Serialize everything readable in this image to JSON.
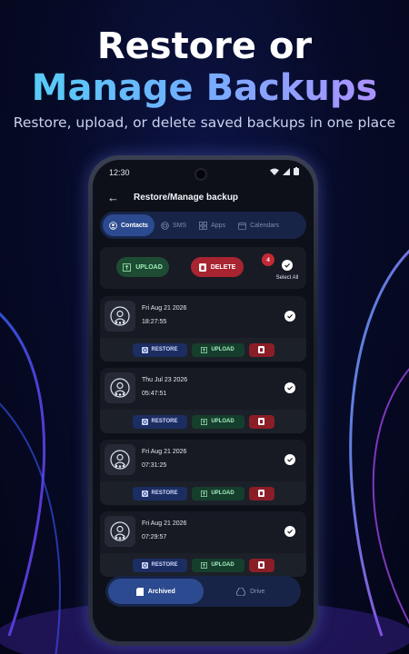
{
  "headline": {
    "line1": "Restore or",
    "line2": "Manage Backups"
  },
  "subline": "Restore, upload, or delete saved backups in one place",
  "status": {
    "time": "12:30"
  },
  "appbar": {
    "title": "Restore/Manage backup"
  },
  "tabs": [
    {
      "label": "Contacts",
      "icon": "contacts-icon",
      "active": true
    },
    {
      "label": "SMS",
      "icon": "sms-icon"
    },
    {
      "label": "Apps",
      "icon": "apps-icon"
    },
    {
      "label": "Calendars",
      "icon": "calendar-icon"
    }
  ],
  "actions": {
    "upload": "UPLOAD",
    "delete": "DELETE",
    "selected_count": "4",
    "select_all": "Select All"
  },
  "backups": [
    {
      "date": "Fri Aug 21 2026",
      "time": "18:27:55",
      "restore": "RESTORE",
      "upload": "UPLOAD"
    },
    {
      "date": "Thu Jul 23 2026",
      "time": "05:47:51",
      "restore": "RESTORE",
      "upload": "UPLOAD"
    },
    {
      "date": "Fri Aug 21 2026",
      "time": "07:31:25",
      "restore": "RESTORE",
      "upload": "UPLOAD"
    },
    {
      "date": "Fri Aug 21 2026",
      "time": "07:29:57",
      "restore": "RESTORE",
      "upload": "UPLOAD"
    }
  ],
  "bottomnav": {
    "archived": "Archived",
    "drive": "Drive"
  },
  "colors": {
    "accent": "#2c4a8f",
    "upload": "#1e4b33",
    "delete": "#a82430",
    "restore": "#1c2d62"
  }
}
